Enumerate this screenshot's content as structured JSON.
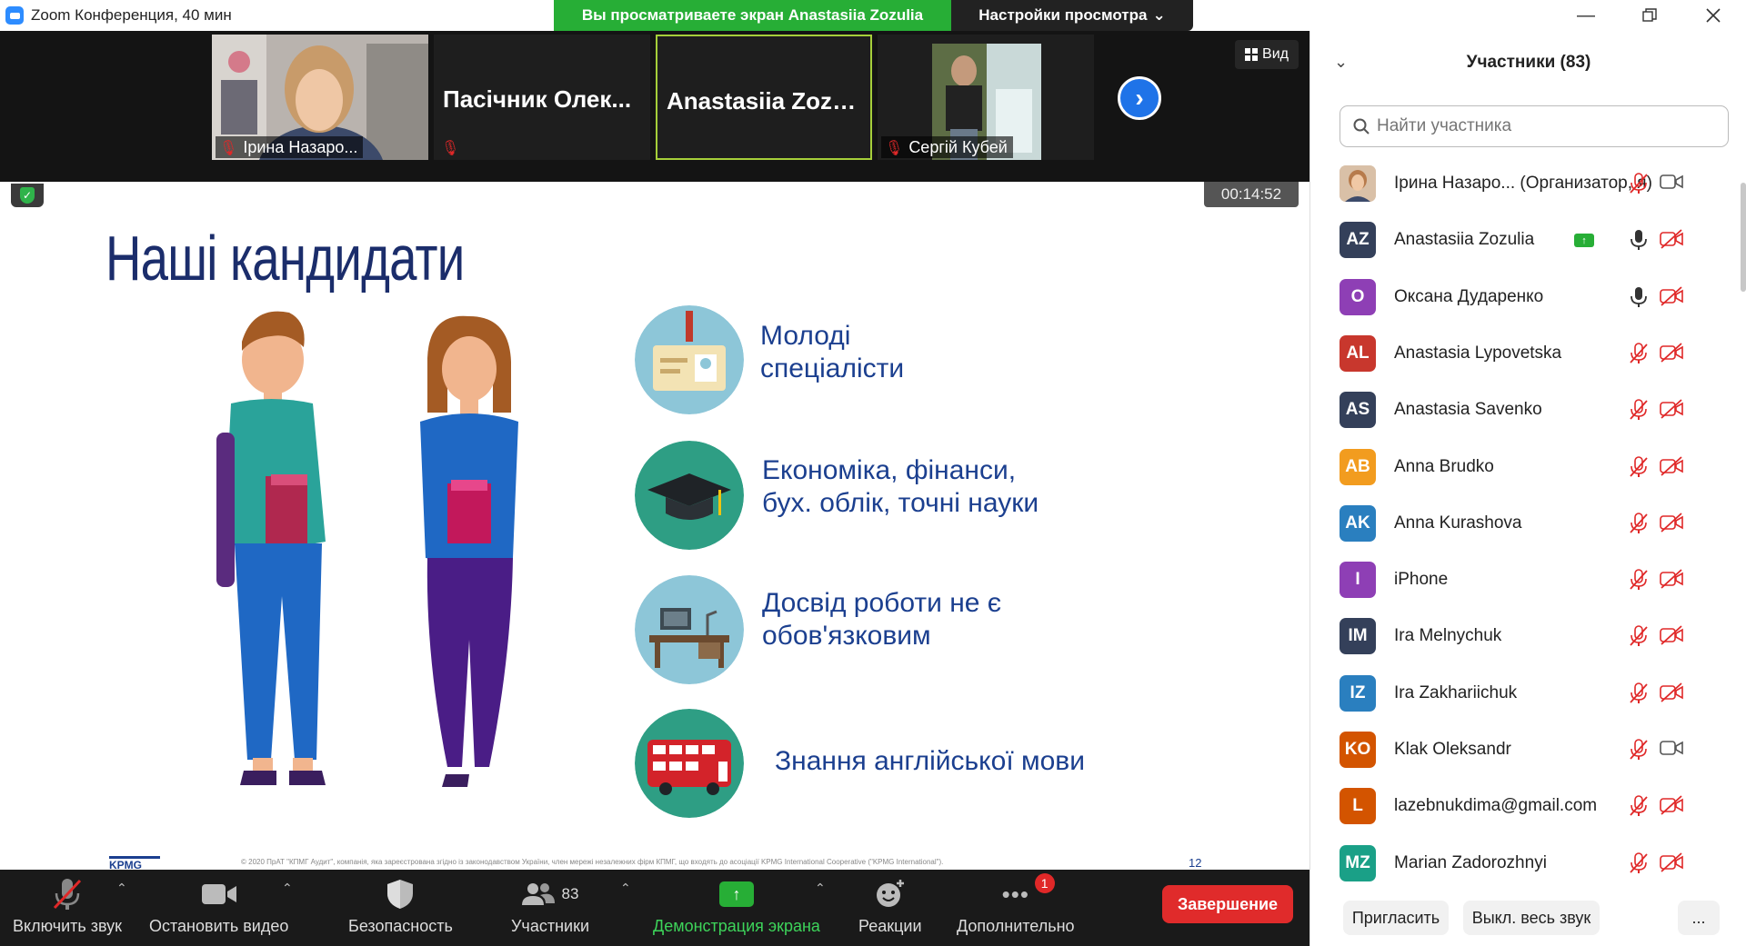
{
  "window": {
    "title": "Zoom Конференция, 40 мин",
    "share_banner": "Вы просматриваете экран Anastasiia Zozulia",
    "view_settings": "Настройки просмотра"
  },
  "strip": {
    "view_label": "Вид",
    "tiles": [
      {
        "label": "Ірина Назаро..."
      },
      {
        "big_name": "Пасічник Олек..."
      },
      {
        "big_name": "Anastasiia Zozu..."
      },
      {
        "label": "Сергій Кубей"
      }
    ]
  },
  "shared": {
    "timer": "00:14:52",
    "slide_title": "Наші кандидати",
    "bullets": [
      {
        "line1": "Молоді",
        "line2": "спеціалісти"
      },
      {
        "line1": "Економіка, фінанси,",
        "line2": "бух. облік, точні науки"
      },
      {
        "line1": "Досвід роботи не є",
        "line2": "обов'язковим"
      },
      {
        "line1": "Знання англійської мови",
        "line2": ""
      }
    ],
    "footer": "© 2020 ПрАТ \"КПМГ Аудит\", компанія, яка зареєстрована згідно із законодавством України, член мережі незалежних фірм КПМГ, що входять до асоціації KPMG International Cooperative (\"KPMG International\").",
    "page_num": "12",
    "logo": "KPMG"
  },
  "toolbar": {
    "unmute": "Включить звук",
    "stop_video": "Остановить видео",
    "security": "Безопасность",
    "participants": "Участники",
    "participants_count": "83",
    "share": "Демонстрация экрана",
    "reactions": "Реакции",
    "more": "Дополнительно",
    "more_badge": "1",
    "end": "Завершение"
  },
  "panel": {
    "title": "Участники (83)",
    "search_placeholder": "Найти участника",
    "participants": [
      {
        "initials": "",
        "name": "Ірина Назаро... (Организатор, я)",
        "color": "#c9a27a",
        "mic": "off",
        "video": "on"
      },
      {
        "initials": "AZ",
        "name": "Anastasiia Zozulia",
        "color": "#34405a",
        "mic": "on",
        "video": "off",
        "sharing": true
      },
      {
        "initials": "О",
        "name": "Оксана Дударенко",
        "color": "#8e3fb5",
        "mic": "on",
        "video": "off"
      },
      {
        "initials": "AL",
        "name": "Anastasia Lypovetska",
        "color": "#c8372d",
        "mic": "off",
        "video": "off"
      },
      {
        "initials": "AS",
        "name": "Anastasia Savenko",
        "color": "#34405a",
        "mic": "off",
        "video": "off"
      },
      {
        "initials": "AB",
        "name": "Anna Brudko",
        "color": "#f29c1f",
        "mic": "off",
        "video": "off"
      },
      {
        "initials": "AK",
        "name": "Anna Kurashova",
        "color": "#2a7fbf",
        "mic": "off",
        "video": "off"
      },
      {
        "initials": "I",
        "name": "iPhone",
        "color": "#8e3fb5",
        "mic": "off",
        "video": "off"
      },
      {
        "initials": "IM",
        "name": "Ira Melnychuk",
        "color": "#34405a",
        "mic": "off",
        "video": "off"
      },
      {
        "initials": "IZ",
        "name": "Ira Zakhariichuk",
        "color": "#2a7fbf",
        "mic": "off",
        "video": "off"
      },
      {
        "initials": "KO",
        "name": "Klak Oleksandr",
        "color": "#d35400",
        "mic": "off",
        "video": "on"
      },
      {
        "initials": "L",
        "name": "lazebnukdima@gmail.com",
        "color": "#d35400",
        "mic": "off",
        "video": "off"
      },
      {
        "initials": "MZ",
        "name": "Marian Zadorozhnyi",
        "color": "#1aa087",
        "mic": "off",
        "video": "off"
      }
    ],
    "invite": "Пригласить",
    "mute_all": "Выкл. весь звук",
    "more": "..."
  }
}
